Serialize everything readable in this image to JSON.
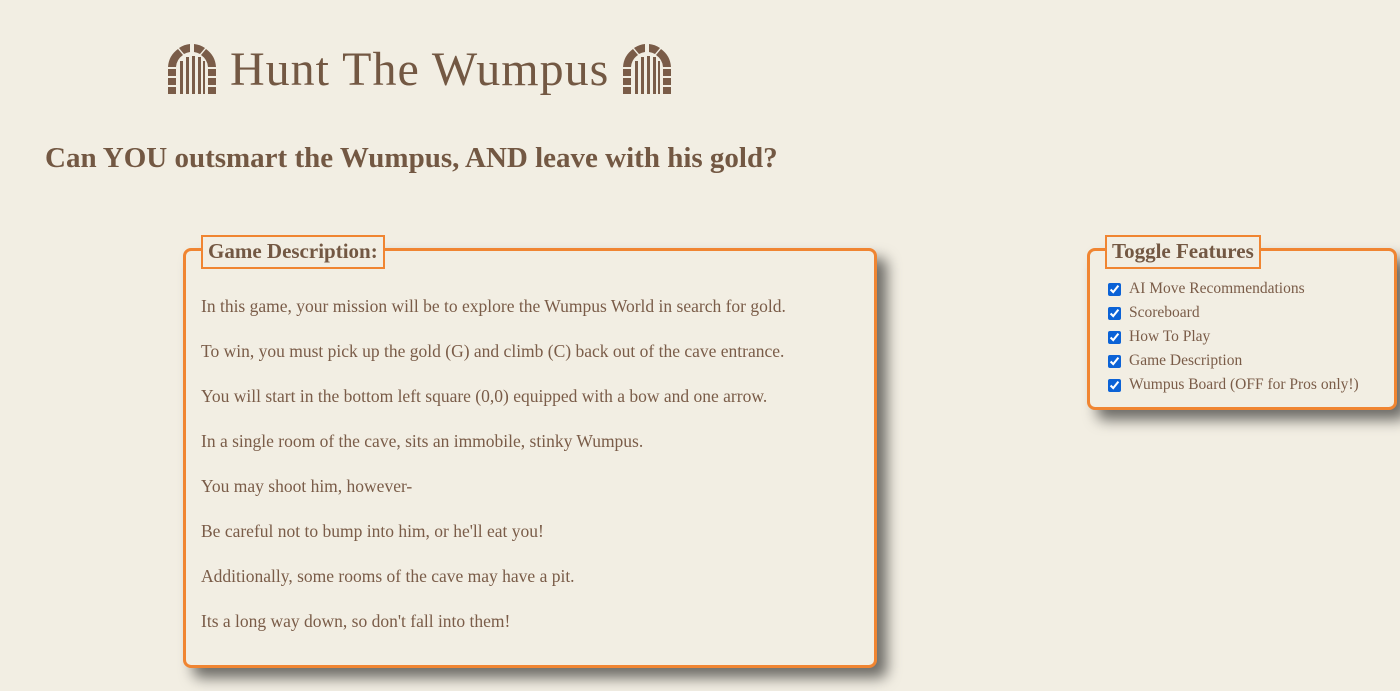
{
  "header": {
    "title": "Hunt The Wumpus",
    "left_icon": "arched-door-icon",
    "right_icon": "arched-door-icon",
    "subtitle": "Can YOU outsmart the Wumpus, AND leave with his gold?"
  },
  "game_description": {
    "legend": "Game Description:",
    "lines": [
      "In this game, your mission will be to explore the Wumpus World in search for gold.",
      "To win, you must pick up the gold (G) and climb (C) back out of the cave entrance.",
      "You will start in the bottom left square (0,0) equipped with a bow and one arrow.",
      "In a single room of the cave, sits an immobile, stinky Wumpus.",
      "You may shoot him, however-",
      "Be careful not to bump into him, or he'll eat you!",
      "Additionally, some rooms of the cave may have a pit.",
      "Its a long way down, so don't fall into them!"
    ]
  },
  "toggle_features": {
    "legend": "Toggle Features",
    "items": [
      {
        "label": "AI Move Recommendations",
        "checked": true
      },
      {
        "label": "Scoreboard",
        "checked": true
      },
      {
        "label": "How To Play",
        "checked": true
      },
      {
        "label": "Game Description",
        "checked": true
      },
      {
        "label": "Wumpus Board (OFF for Pros only!)",
        "checked": true
      }
    ]
  },
  "colors": {
    "background": "#f2eee3",
    "text": "#735843",
    "accent_border": "#f08532",
    "checkbox": "#0b62d6"
  }
}
